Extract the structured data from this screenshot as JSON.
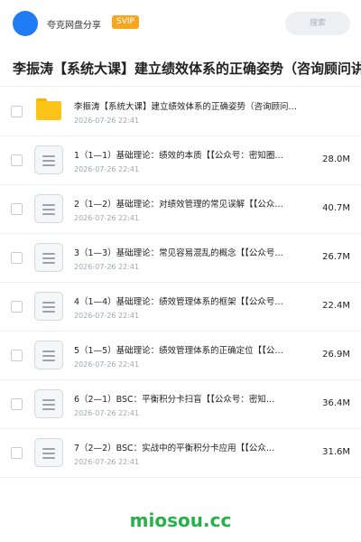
{
  "header": {
    "username": "夸克网盘分享",
    "badge": "SVIP",
    "search_placeholder": "搜索",
    "avatar_color": "#1f7cf5",
    "badge_color": "#f5a623"
  },
  "title": "李振涛【系统大课】建立绩效体系的正确姿势（咨询顾问讲",
  "files": [
    {
      "type": "folder",
      "icon": "folder-icon",
      "name": "李振涛【系统大课】建立绩效体系的正确姿势（咨询顾问…",
      "date": "2026-07-26 22:41",
      "size": ""
    },
    {
      "type": "doc",
      "icon": "document-icon",
      "name": "1（1—1）基础理论：绩效的本质【【公众号：密知圈…",
      "date": "2026-07-26 22:41",
      "size": "28.0M"
    },
    {
      "type": "doc",
      "icon": "document-icon",
      "name": "2（1—2）基础理论：对绩效管理的常见误解【【公众…",
      "date": "2026-07-26 22:41",
      "size": "40.7M"
    },
    {
      "type": "doc",
      "icon": "document-icon",
      "name": "3（1—3）基础理论：常见容易混乱的概念【【公众号…",
      "date": "2026-07-26 22:41",
      "size": "26.7M"
    },
    {
      "type": "doc",
      "icon": "document-icon",
      "name": "4（1—4）基础理论：绩效管理体系的框架【【公众号…",
      "date": "2026-07-26 22:41",
      "size": "22.4M"
    },
    {
      "type": "doc",
      "icon": "document-icon",
      "name": "5（1—5）基础理论：绩效管理体系的正确定位【【公…",
      "date": "2026-07-26 22:41",
      "size": "26.9M"
    },
    {
      "type": "doc",
      "icon": "document-icon",
      "name": "6（2—1）BSC：平衡积分卡扫盲【【公众号：密知…",
      "date": "2026-07-26 22:41",
      "size": "36.4M"
    },
    {
      "type": "doc",
      "icon": "document-icon",
      "name": "7（2—2）BSC：实战中的平衡积分卡应用【【公众…",
      "date": "2026-07-26 22:41",
      "size": "31.6M"
    }
  ],
  "watermark": "miosou.cc",
  "watermark_color": "#27b14a"
}
